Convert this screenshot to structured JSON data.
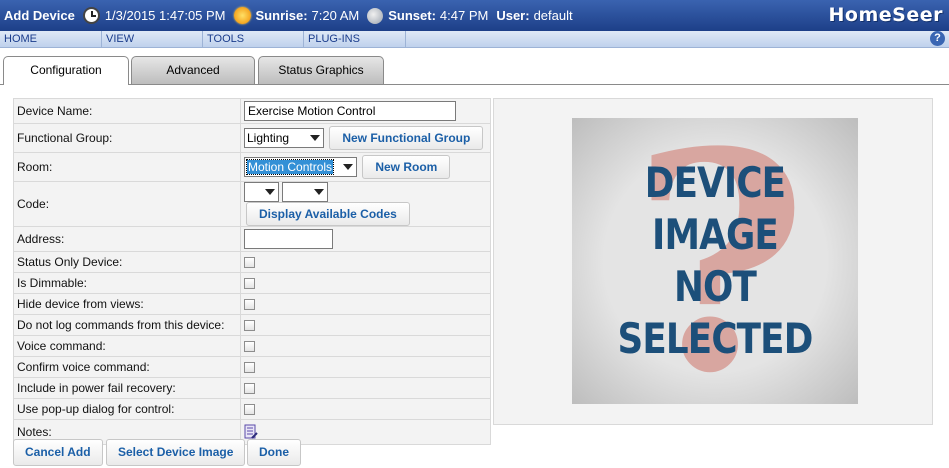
{
  "header": {
    "title": "Add Device",
    "datetime": "1/3/2015 1:47:05 PM",
    "sunrise_label": "Sunrise:",
    "sunrise": "7:20 AM",
    "sunset_label": "Sunset:",
    "sunset": "4:47 PM",
    "user_label": "User:",
    "user": "default",
    "logo": "HomeSeer"
  },
  "menu": [
    "HOME",
    "VIEW",
    "TOOLS",
    "PLUG-INS"
  ],
  "help": "?",
  "tabs": [
    {
      "label": "Configuration",
      "active": true
    },
    {
      "label": "Advanced",
      "active": false
    },
    {
      "label": "Status Graphics",
      "active": false
    }
  ],
  "form": {
    "device_name_label": "Device Name:",
    "device_name_value": "Exercise Motion Control",
    "functional_group_label": "Functional Group:",
    "functional_group_value": "Lighting",
    "new_functional_group_button": "New Functional Group",
    "room_label": "Room:",
    "room_value": "Motion Controls",
    "new_room_button": "New Room",
    "code_label": "Code:",
    "code_house_value": "",
    "code_unit_value": "",
    "display_codes_button": "Display Available Codes",
    "address_label": "Address:",
    "address_value": "",
    "checkboxes": [
      {
        "label": "Status Only Device:",
        "checked": false
      },
      {
        "label": "Is Dimmable:",
        "checked": false
      },
      {
        "label": "Hide device from views:",
        "checked": false
      },
      {
        "label": "Do not log commands from this device:",
        "checked": false
      },
      {
        "label": "Voice command:",
        "checked": false
      },
      {
        "label": "Confirm voice command:",
        "checked": false
      },
      {
        "label": "Include in power fail recovery:",
        "checked": false
      },
      {
        "label": "Use pop-up dialog for control:",
        "checked": false
      }
    ],
    "notes_label": "Notes:"
  },
  "device_image": {
    "lines": [
      "DEVICE",
      "IMAGE",
      "NOT",
      "SELECTED"
    ],
    "question_mark": "?"
  },
  "footer": {
    "cancel_add": "Cancel Add",
    "select_device_image": "Select Device Image",
    "done": "Done"
  },
  "colors": {
    "titlebar": "#1d3f88",
    "menu_text": "#1a3c8c",
    "button_text": "#1b5fa7",
    "room_highlight": "#3390d6"
  }
}
